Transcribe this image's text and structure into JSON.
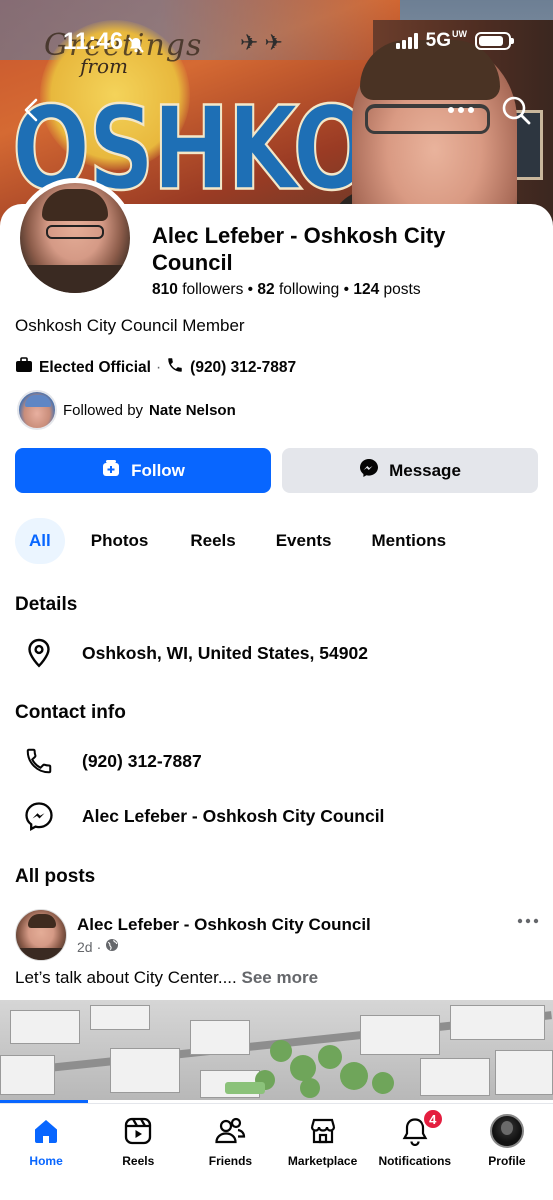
{
  "status_bar": {
    "time": "11:46",
    "network": "5G",
    "network_suffix": "UW",
    "battery_level": 0.85
  },
  "cover": {
    "mural_greeting": "Greetings",
    "mural_from": "from",
    "mural_city": "OSHKOSH"
  },
  "profile": {
    "name": "Alec Lefeber - Oshkosh City Council",
    "followers_count": "810",
    "followers_label": "followers",
    "following_count": "82",
    "following_label": "following",
    "posts_count": "124",
    "posts_label": "posts",
    "separator": "•",
    "bio": "Oshkosh City Council Member",
    "category": "Elected Official",
    "phone": "(920) 312-7887",
    "followed_by_prefix": "Followed by",
    "followed_by_name": "Nate Nelson"
  },
  "actions": {
    "follow_label": "Follow",
    "message_label": "Message"
  },
  "tabs": [
    {
      "label": "All",
      "active": true
    },
    {
      "label": "Photos",
      "active": false
    },
    {
      "label": "Reels",
      "active": false
    },
    {
      "label": "Events",
      "active": false
    },
    {
      "label": "Mentions",
      "active": false
    }
  ],
  "details": {
    "title": "Details",
    "location": "Oshkosh, WI, United States, 54902"
  },
  "contact": {
    "title": "Contact info",
    "phone": "(920) 312-7887",
    "messenger": "Alec Lefeber - Oshkosh City Council"
  },
  "posts": {
    "title": "All posts",
    "author": "Alec Lefeber - Oshkosh City Council",
    "age": "2d",
    "dot": "·",
    "text": "Let’s talk about City Center....",
    "see_more": "See more"
  },
  "bottom_nav": [
    {
      "label": "Home",
      "active": true
    },
    {
      "label": "Reels",
      "active": false
    },
    {
      "label": "Friends",
      "active": false
    },
    {
      "label": "Marketplace",
      "active": false
    },
    {
      "label": "Notifications",
      "active": false,
      "badge": "4"
    },
    {
      "label": "Profile",
      "active": false
    }
  ],
  "colors": {
    "accent": "#0866ff",
    "text": "#050505",
    "secondary": "#65676b",
    "badge": "#e41e3f",
    "button_secondary": "#e4e6eb",
    "tab_active_bg": "#ebf5ff"
  }
}
